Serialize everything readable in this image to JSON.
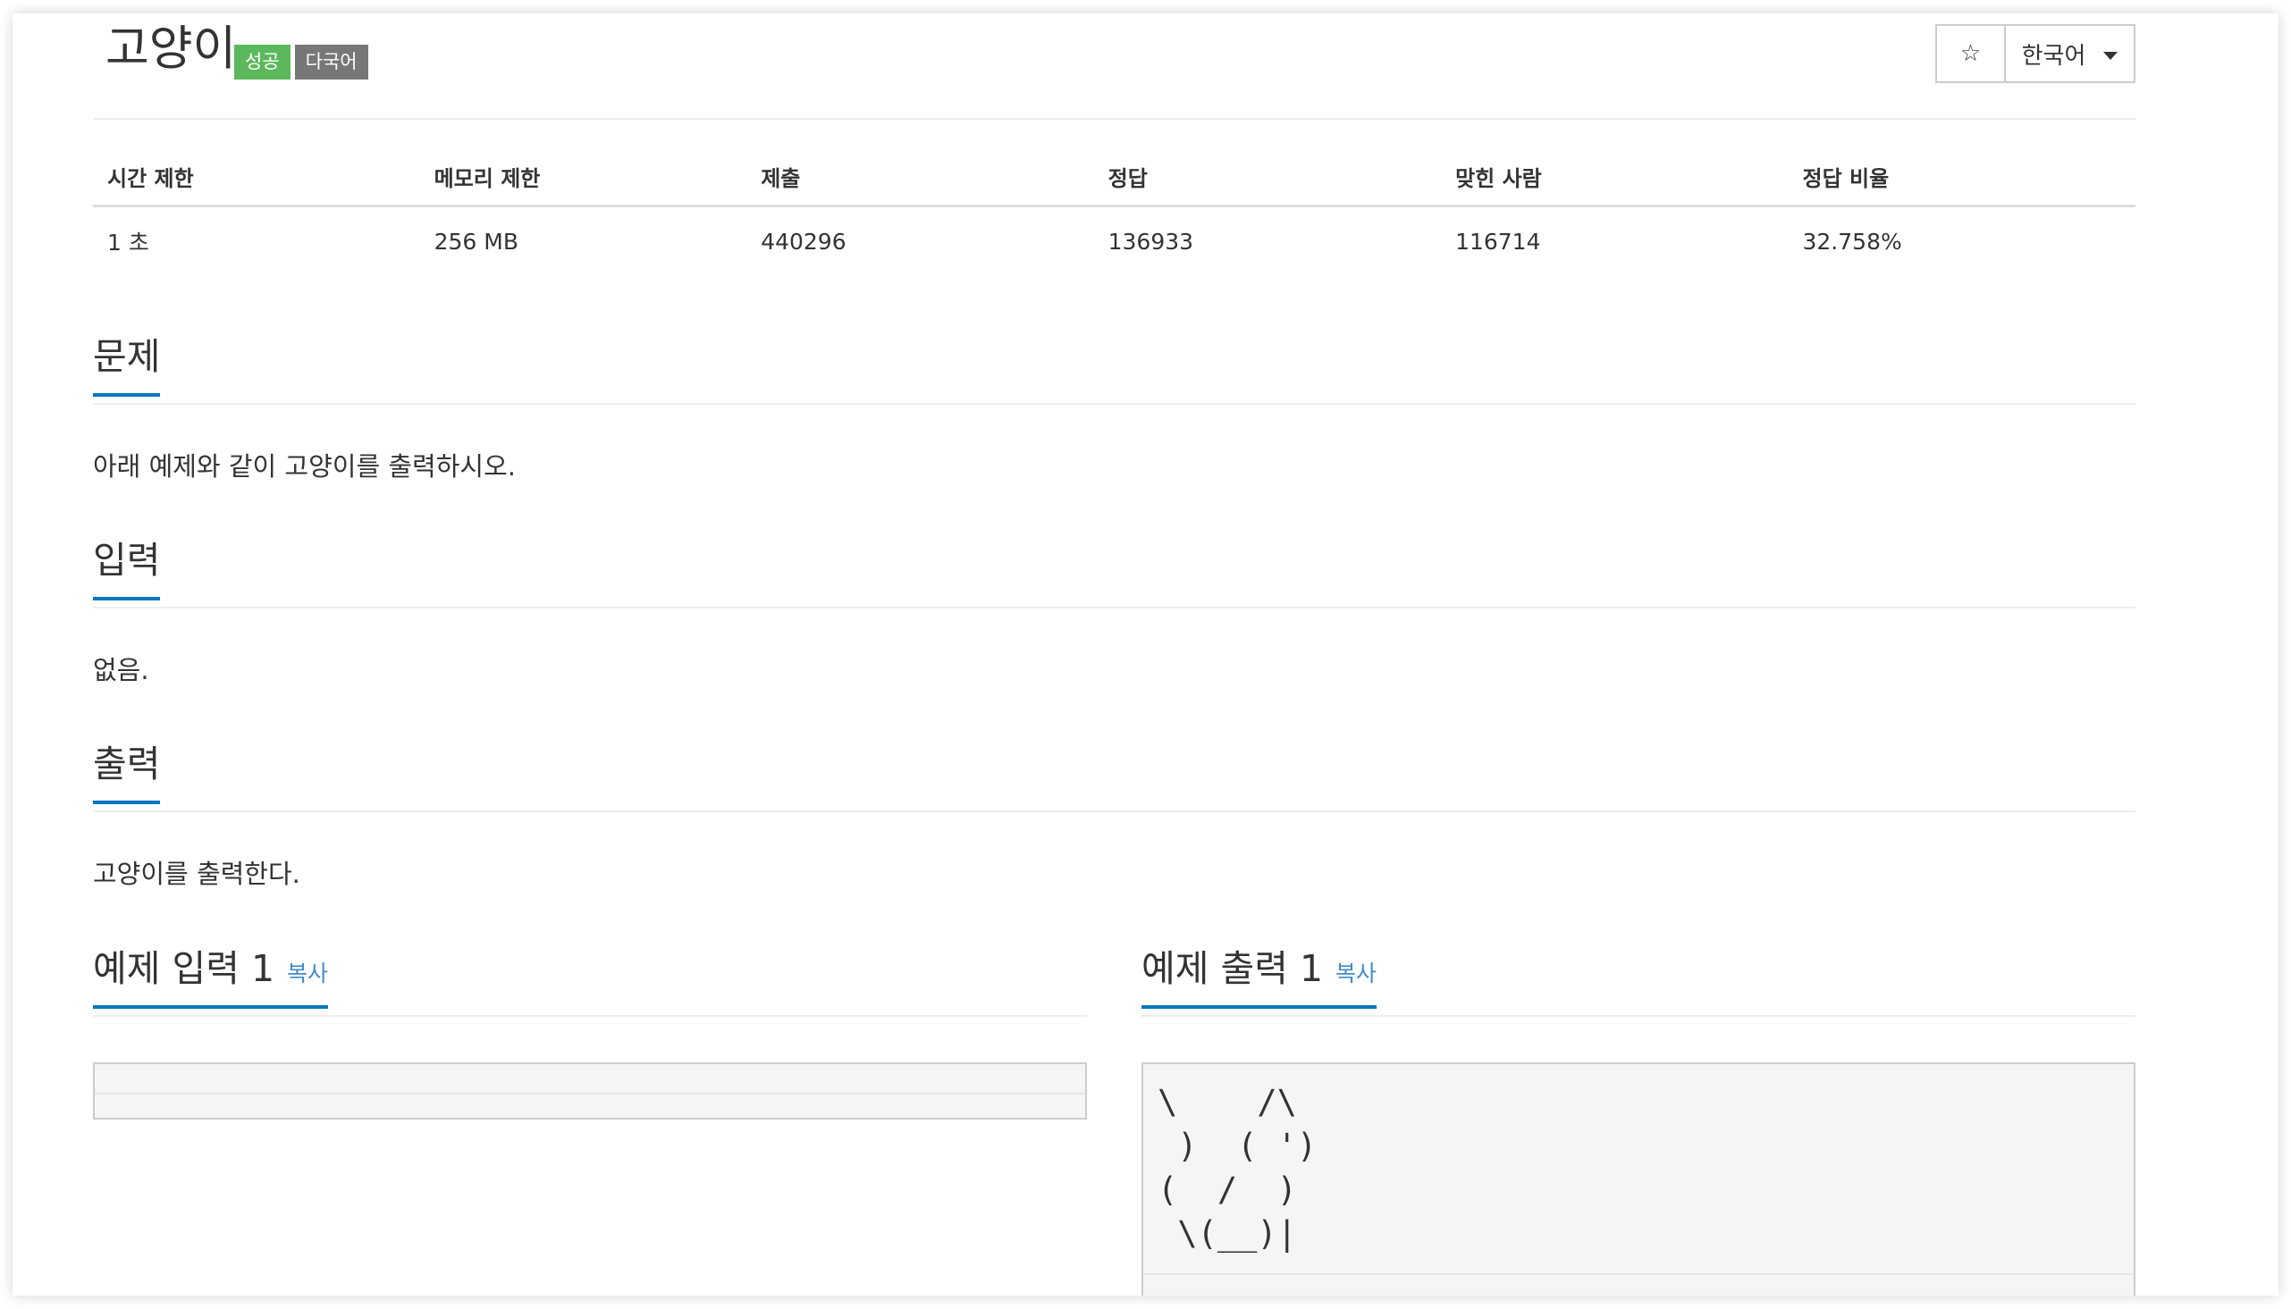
{
  "problem": {
    "title": "고양이",
    "badges": [
      "성공",
      "다국어"
    ]
  },
  "toolbar": {
    "star_icon": "star-icon",
    "star_glyph": "☆",
    "language": "한국어"
  },
  "stats": {
    "headers": [
      "시간 제한",
      "메모리 제한",
      "제출",
      "정답",
      "맞힌 사람",
      "정답 비율"
    ],
    "values": [
      "1 초",
      "256 MB",
      "440296",
      "136933",
      "116714",
      "32.758%"
    ]
  },
  "sections": {
    "problem": {
      "title": "문제",
      "text": "아래 예제와 같이 고양이를 출력하시오."
    },
    "input": {
      "title": "입력",
      "text": "없음."
    },
    "output": {
      "title": "출력",
      "text": "고양이를 출력한다."
    }
  },
  "samples": {
    "input": {
      "title": "예제 입력 1",
      "copy": "복사",
      "content": ""
    },
    "output": {
      "title": "예제 출력 1",
      "copy": "복사",
      "content": "\\    /\\\n )  ( ')\n(  /  )\n \\(__)|"
    }
  }
}
